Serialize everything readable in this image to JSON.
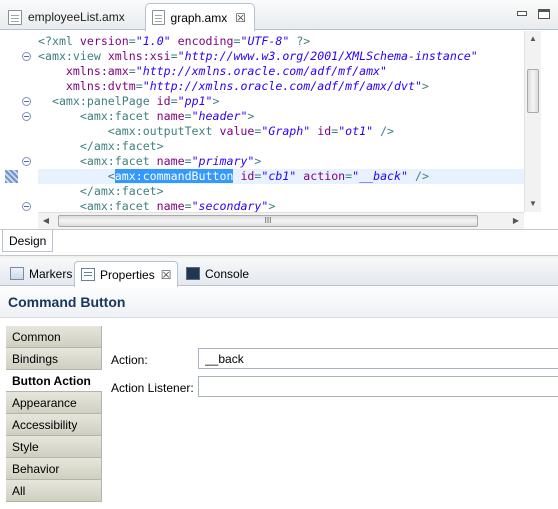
{
  "editor": {
    "tabs": [
      {
        "label": "employeeList.amx",
        "active": false
      },
      {
        "label": "graph.amx",
        "active": true,
        "close": "☒"
      }
    ],
    "code_lines": [
      {
        "fold": false,
        "parts": [
          [
            "pi",
            "<?xml "
          ],
          [
            "attr",
            "version"
          ],
          [
            "pi",
            "="
          ],
          [
            "str",
            "\"1.0\""
          ],
          [
            "pi",
            " "
          ],
          [
            "attr",
            "encoding"
          ],
          [
            "pi",
            "="
          ],
          [
            "str",
            "\"UTF-8\""
          ],
          [
            "pi",
            " ?>"
          ]
        ]
      },
      {
        "fold": true,
        "parts": [
          [
            "tag",
            "<amx:view "
          ],
          [
            "attr",
            "xmlns:xsi"
          ],
          [
            "tag",
            "="
          ],
          [
            "str",
            "\"http://www.w3.org/2001/XMLSchema-instance\""
          ]
        ]
      },
      {
        "fold": false,
        "parts": [
          [
            "attr",
            "    xmlns:amx"
          ],
          [
            "tag",
            "="
          ],
          [
            "str",
            "\"http://xmlns.oracle.com/adf/mf/amx\""
          ]
        ]
      },
      {
        "fold": false,
        "parts": [
          [
            "attr",
            "    xmlns:dvtm"
          ],
          [
            "tag",
            "="
          ],
          [
            "str",
            "\"http://xmlns.oracle.com/adf/mf/amx/dvt\""
          ],
          [
            "tag",
            ">"
          ]
        ]
      },
      {
        "fold": true,
        "parts": [
          [
            "tag",
            "  <amx:panelPage "
          ],
          [
            "attr",
            "id"
          ],
          [
            "tag",
            "="
          ],
          [
            "str",
            "\"pp1\""
          ],
          [
            "tag",
            ">"
          ]
        ]
      },
      {
        "fold": true,
        "parts": [
          [
            "tag",
            "      <amx:facet "
          ],
          [
            "attr",
            "name"
          ],
          [
            "tag",
            "="
          ],
          [
            "str",
            "\"header\""
          ],
          [
            "tag",
            ">"
          ]
        ]
      },
      {
        "fold": false,
        "parts": [
          [
            "tag",
            "          <amx:outputText "
          ],
          [
            "attr",
            "value"
          ],
          [
            "tag",
            "="
          ],
          [
            "str",
            "\"Graph\""
          ],
          [
            "tag",
            " "
          ],
          [
            "attr",
            "id"
          ],
          [
            "tag",
            "="
          ],
          [
            "str",
            "\"ot1\""
          ],
          [
            "tag",
            " />"
          ]
        ]
      },
      {
        "fold": false,
        "parts": [
          [
            "tag",
            "      </amx:facet>"
          ]
        ]
      },
      {
        "fold": true,
        "parts": [
          [
            "tag",
            "      <amx:facet "
          ],
          [
            "attr",
            "name"
          ],
          [
            "tag",
            "="
          ],
          [
            "str",
            "\"primary\""
          ],
          [
            "tag",
            ">"
          ]
        ]
      },
      {
        "fold": false,
        "highlight": true,
        "parts": [
          [
            "tag",
            "          <"
          ],
          [
            "sel",
            "amx:commandButton"
          ],
          [
            "tag",
            " "
          ],
          [
            "attr",
            "id"
          ],
          [
            "tag",
            "="
          ],
          [
            "str",
            "\"cb1\""
          ],
          [
            "tag",
            " "
          ],
          [
            "attr",
            "action"
          ],
          [
            "tag",
            "="
          ],
          [
            "str",
            "\"__back\""
          ],
          [
            "tag",
            " />"
          ]
        ]
      },
      {
        "fold": false,
        "parts": [
          [
            "tag",
            "      </amx:facet>"
          ]
        ]
      },
      {
        "fold": true,
        "parts": [
          [
            "tag",
            "      <amx:facet "
          ],
          [
            "attr",
            "name"
          ],
          [
            "tag",
            "="
          ],
          [
            "str",
            "\"secondary\""
          ],
          [
            "tag",
            ">"
          ]
        ]
      }
    ],
    "hscroll_grip": "III",
    "design_tab": "Design"
  },
  "views": {
    "tabs": [
      {
        "label": "Markers"
      },
      {
        "label": "Properties",
        "close": "☒"
      },
      {
        "label": "Console"
      }
    ]
  },
  "properties": {
    "title": "Command Button",
    "categories": [
      "Common",
      "Bindings",
      "Button Action",
      "Appearance",
      "Accessibility",
      "Style",
      "Behavior",
      "All"
    ],
    "active_category": "Button Action",
    "fields": [
      {
        "label": "Action:",
        "value": "__back"
      },
      {
        "label": "Action Listener:",
        "value": ""
      }
    ]
  }
}
